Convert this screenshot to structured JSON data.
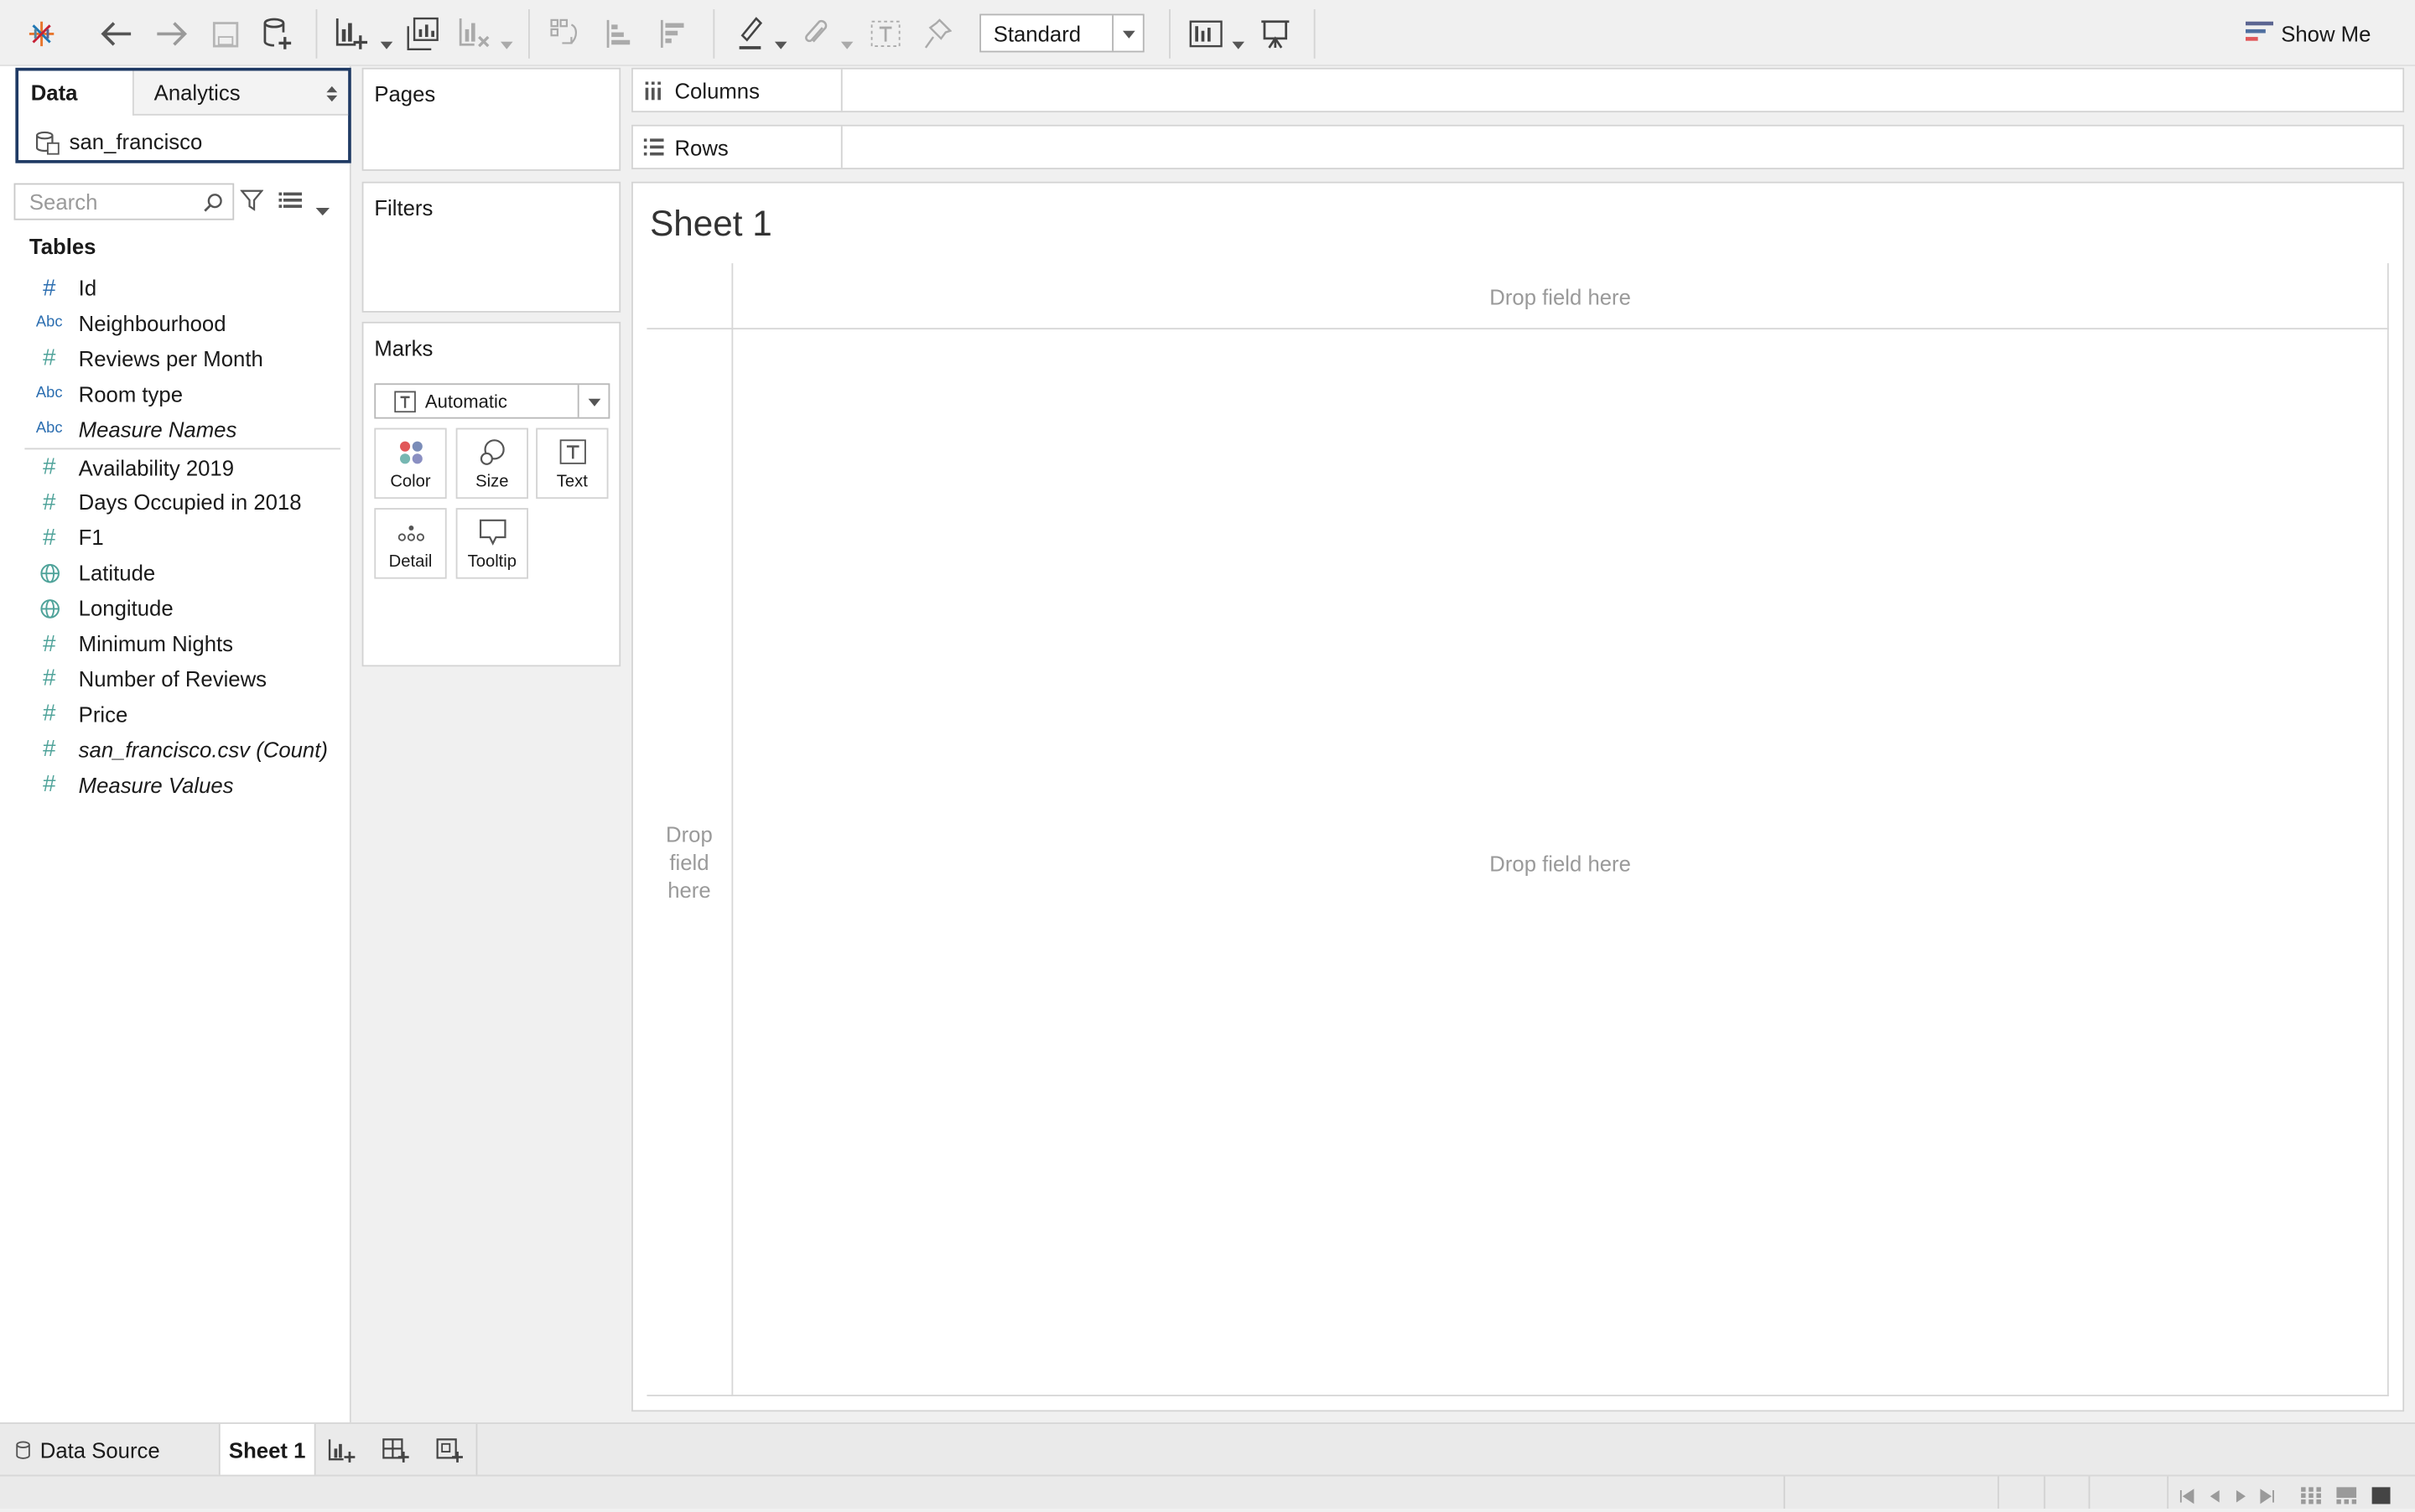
{
  "toolbar": {
    "view_mode_value": "Standard",
    "show_me_label": "Show Me"
  },
  "data_pane": {
    "tabs": [
      "Data",
      "Analytics"
    ],
    "datasource_name": "san_francisco",
    "search_placeholder": "Search",
    "tables_heading": "Tables",
    "fields": [
      {
        "label": "Id",
        "type": "hash-blue"
      },
      {
        "label": "Neighbourhood",
        "type": "abc"
      },
      {
        "label": "Reviews per Month",
        "type": "hash"
      },
      {
        "label": "Room type",
        "type": "abc"
      },
      {
        "label": "Measure Names",
        "type": "abc",
        "italic": true
      },
      {
        "label": "Availability 2019",
        "type": "hash"
      },
      {
        "label": "Days Occupied in 2018",
        "type": "hash"
      },
      {
        "label": "F1",
        "type": "hash"
      },
      {
        "label": "Latitude",
        "type": "globe"
      },
      {
        "label": "Longitude",
        "type": "globe"
      },
      {
        "label": "Minimum Nights",
        "type": "hash"
      },
      {
        "label": "Number of Reviews",
        "type": "hash"
      },
      {
        "label": "Price",
        "type": "hash"
      },
      {
        "label": "san_francisco.csv (Count)",
        "type": "hash",
        "italic": true
      },
      {
        "label": "Measure Values",
        "type": "hash",
        "italic": true
      }
    ],
    "type_badge_abc": "Abc"
  },
  "cards": {
    "pages": "Pages",
    "filters": "Filters",
    "marks": "Marks",
    "mark_type": "Automatic",
    "mark_buttons": {
      "color": "Color",
      "size": "Size",
      "text": "Text",
      "detail": "Detail",
      "tooltip": "Tooltip"
    }
  },
  "shelves": {
    "columns": "Columns",
    "rows": "Rows"
  },
  "view": {
    "sheet_title": "Sheet 1",
    "drop_top": "Drop field here",
    "drop_center": "Drop field here",
    "drop_left": [
      "Drop",
      "field",
      "here"
    ]
  },
  "bottom_tabs": {
    "data_source": "Data Source",
    "sheet": "Sheet 1"
  },
  "colors": {
    "accent_border": "#1f3a64",
    "measure_icon": "#4fa39a",
    "dimension_icon": "#2d6fb1"
  }
}
